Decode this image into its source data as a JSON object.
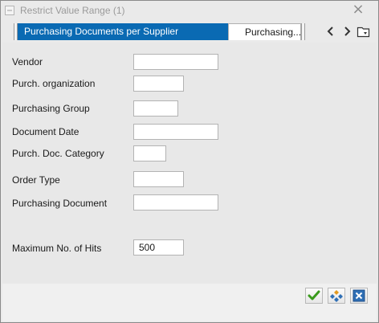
{
  "window": {
    "title": "Restrict Value Range (1)"
  },
  "tabs": [
    {
      "label": "Purchasing Documents per Supplier",
      "active": true
    },
    {
      "label": "Purchasing...",
      "active": false
    }
  ],
  "tab_nav": {
    "icons": [
      "chevron-left-icon",
      "chevron-right-icon",
      "tab-list-icon"
    ]
  },
  "form": {
    "fields": [
      {
        "label": "Vendor",
        "value": ""
      },
      {
        "label": "Purch. organization",
        "value": ""
      },
      {
        "label": "Purchasing Group",
        "value": ""
      },
      {
        "label": "Document Date",
        "value": ""
      },
      {
        "label": "Purch. Doc. Category",
        "value": ""
      },
      {
        "label": "Order Type",
        "value": ""
      },
      {
        "label": "Purchasing Document",
        "value": ""
      }
    ],
    "max_hits": {
      "label": "Maximum No. of Hits",
      "value": "500"
    }
  },
  "footer": {
    "buttons": [
      "confirm-check-icon",
      "multiple-selection-icon",
      "cancel-close-icon"
    ]
  },
  "colors": {
    "active_tab": "#0a6ab3",
    "confirm_green": "#3a9a1c",
    "cancel_blue": "#2f6fb5"
  }
}
